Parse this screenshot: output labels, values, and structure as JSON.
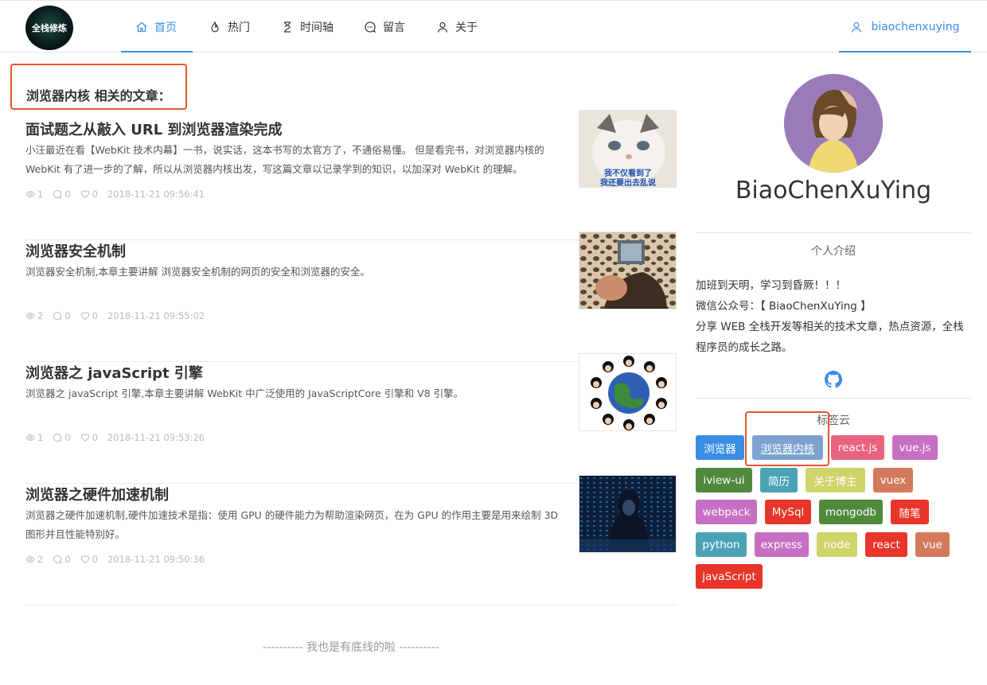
{
  "logo": {
    "text": "全栈修炼"
  },
  "nav": {
    "items": [
      {
        "label": "首页",
        "icon": "home-icon",
        "active": true
      },
      {
        "label": "热门",
        "icon": "flame-icon"
      },
      {
        "label": "时间轴",
        "icon": "hourglass-icon"
      },
      {
        "label": "留言",
        "icon": "chat-icon"
      },
      {
        "label": "关于",
        "icon": "user-icon"
      }
    ],
    "user": "biaochenxuying"
  },
  "heading": "浏览器内核 相关的文章：",
  "articles": [
    {
      "title": "面试题之从敲入 URL 到浏览器渲染完成",
      "desc": "小汪最近在看【WebKit 技术内幕】一书，说实话，这本书写的太官方了，不通俗易懂。 但是看完书，对浏览器内核的 WebKit 有了进一步的了解，所以从浏览器内核出发，写这篇文章以记录学到的知识，以加深对 WebKit 的理解。",
      "views": "1",
      "comments": "0",
      "likes": "0",
      "date": "2018-11-21 09:56:41",
      "thumb_caption": "我不仅看到了\n我还要出去乱说"
    },
    {
      "title": "浏览器安全机制",
      "desc": "浏览器安全机制,本章主要讲解 浏览器安全机制的网页的安全和浏览器的安全。",
      "views": "2",
      "comments": "0",
      "likes": "0",
      "date": "2018-11-21 09:55:02"
    },
    {
      "title": "浏览器之 javaScript 引擎",
      "desc": "浏览器之 javaScript 引擎,本章主要讲解 WebKit 中广泛使用的 JavaScriptCore 引擎和 V8 引擎。",
      "views": "1",
      "comments": "0",
      "likes": "0",
      "date": "2018-11-21 09:53:26"
    },
    {
      "title": "浏览器之硬件加速机制",
      "desc": "浏览器之硬件加速机制,硬件加速技术是指：使用 GPU 的硬件能力为帮助渲染网页，在为 GPU 的作用主要是用来绘制 3D 图形并且性能特别好。",
      "views": "2",
      "comments": "0",
      "likes": "0",
      "date": "2018-11-21 09:50:36"
    }
  ],
  "profile": {
    "name": "BiaoChenXuYing",
    "intro_title": "个人介绍",
    "intro_lines": [
      "加班到天明，学习到昏厥！！！",
      "微信公众号：【 BiaoChenXuYing 】",
      "分享 WEB 全栈开发等相关的技术文章，热点资源，全栈程序员的成长之路。"
    ],
    "github_icon": "github-icon"
  },
  "tags": {
    "title": "标签云",
    "items": [
      {
        "label": "浏览器",
        "color": "#3a8ee6"
      },
      {
        "label": "浏览器内核",
        "color": "#7ea2cf"
      },
      {
        "label": "react.js",
        "color": "#e8637f"
      },
      {
        "label": "vue.js",
        "color": "#c66fc3"
      },
      {
        "label": "iview-ui",
        "color": "#4f8a3c"
      },
      {
        "label": "简历",
        "color": "#4aa3b5"
      },
      {
        "label": "关于博主",
        "color": "#cfd46a"
      },
      {
        "label": "vuex",
        "color": "#d47a5c"
      },
      {
        "label": "webpack",
        "color": "#c66fc3"
      },
      {
        "label": "MySql",
        "color": "#e8352a"
      },
      {
        "label": "mongodb",
        "color": "#4f8a3c"
      },
      {
        "label": "随笔",
        "color": "#e8352a"
      },
      {
        "label": "python",
        "color": "#4aa3b5"
      },
      {
        "label": "express",
        "color": "#c66fc3"
      },
      {
        "label": "node",
        "color": "#cfd46a"
      },
      {
        "label": "react",
        "color": "#e8352a"
      },
      {
        "label": "vue",
        "color": "#d47a5c"
      },
      {
        "label": "javaScript",
        "color": "#e8352a"
      }
    ]
  },
  "footer": "---------- 我也是有底线的啦 ----------"
}
